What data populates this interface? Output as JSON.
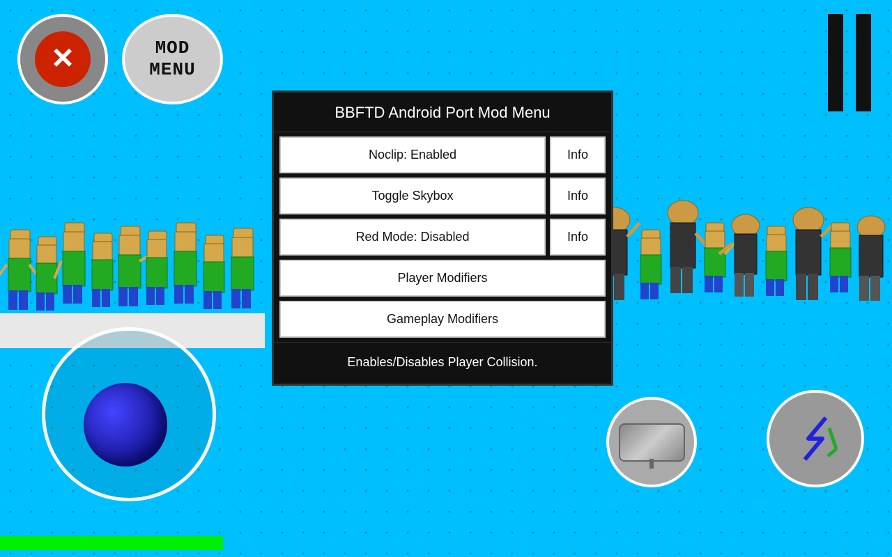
{
  "title": "BBFTD Android Port Mod Menu",
  "close_button": "×",
  "mod_menu_label": "MOD\nMENU",
  "pause_bars": 2,
  "menu_items": [
    {
      "id": "noclip",
      "label": "Noclip: Enabled",
      "has_info": true,
      "info_label": "Info"
    },
    {
      "id": "toggle_skybox",
      "label": "Toggle Skybox",
      "has_info": true,
      "info_label": "Info"
    },
    {
      "id": "red_mode",
      "label": "Red Mode: Disabled",
      "has_info": true,
      "info_label": "Info"
    },
    {
      "id": "player_modifiers",
      "label": "Player Modifiers",
      "has_info": false
    },
    {
      "id": "gameplay_modifiers",
      "label": "Gameplay Modifiers",
      "has_info": false
    }
  ],
  "description": "Enables/Disables Player Collision.",
  "colors": {
    "background": "#00BFFF",
    "panel_bg": "#111111",
    "button_bg": "#ffffff",
    "accent_green": "#00ee00",
    "close_red": "#cc2200"
  }
}
